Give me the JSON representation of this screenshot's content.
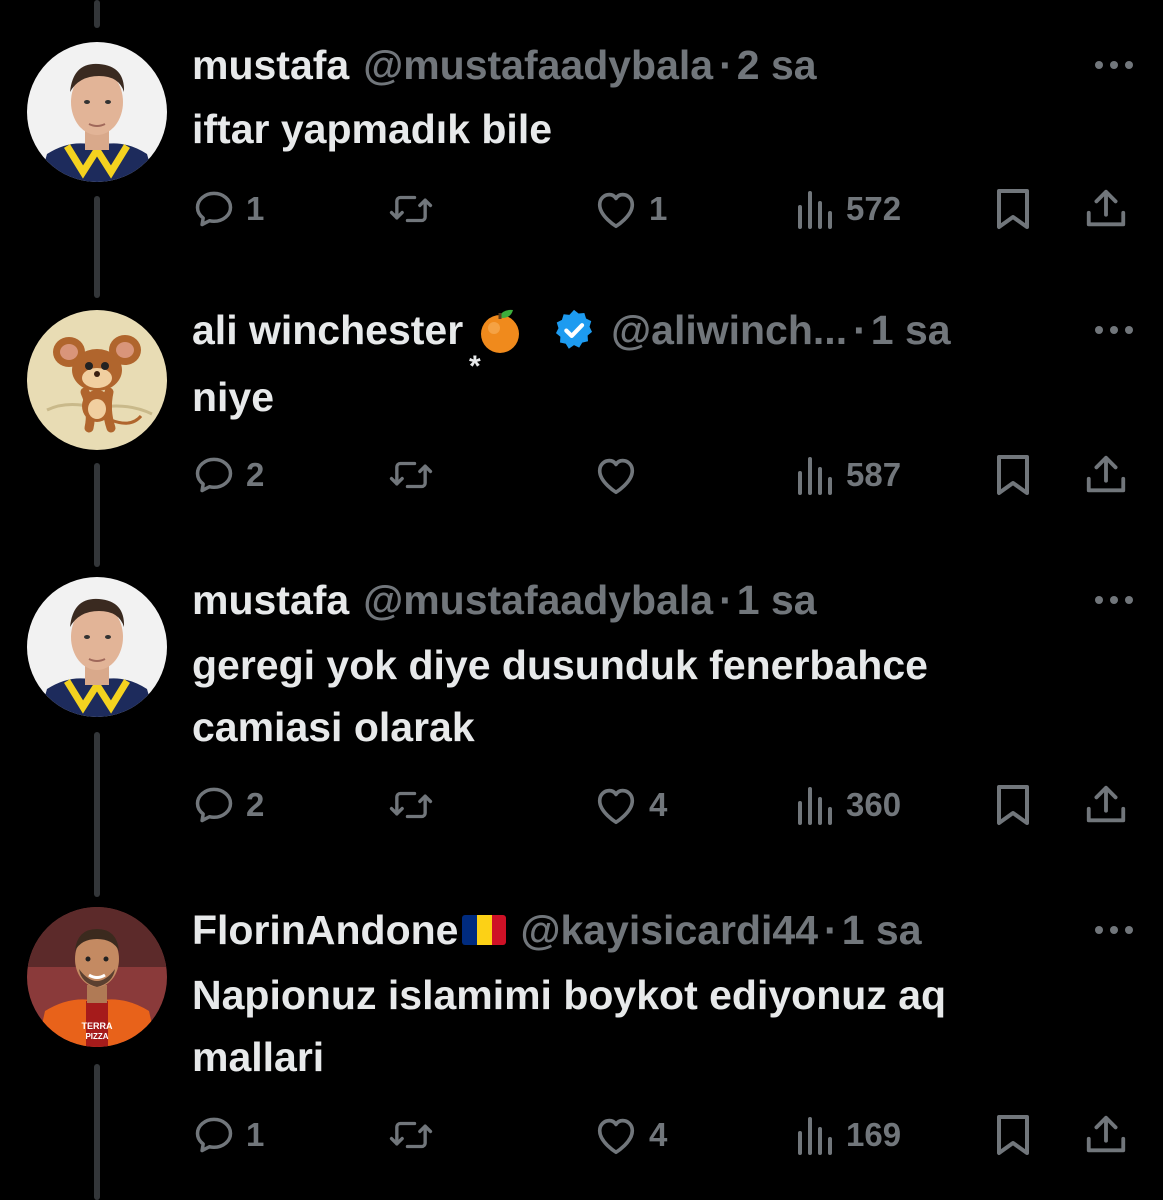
{
  "tweets": [
    {
      "name": "mustafa",
      "handle": "@mustafaadybala",
      "separator": "·",
      "time": "2 sa",
      "lines": [
        "iftar yapmadık bile"
      ],
      "replies": "1",
      "retweets": "",
      "likes": "1",
      "views": "572",
      "avatar": "footballer-avatar-yellow-navy"
    },
    {
      "name": "ali winchester",
      "name_decoration": "*",
      "emoji": "tangerine-emoji",
      "verified": true,
      "handle": "@aliwinch...",
      "separator": "·",
      "time": "1 sa",
      "lines": [
        "niye"
      ],
      "replies": "2",
      "retweets": "",
      "likes": "",
      "views": "587",
      "avatar": "cartoon-mouse-avatar"
    },
    {
      "name": "mustafa",
      "handle": "@mustafaadybala",
      "separator": "·",
      "time": "1 sa",
      "lines": [
        "geregi yok diye dusunduk fenerbahce",
        "camiasi olarak"
      ],
      "replies": "2",
      "retweets": "",
      "likes": "4",
      "views": "360",
      "avatar": "footballer-avatar-yellow-navy"
    },
    {
      "name": "FlorinAndone",
      "flag": "romania-flag",
      "handle": "@kayisicardi44",
      "separator": "·",
      "time": "1 sa",
      "lines": [
        "Napionuz islamimi boykot ediyonuz aq",
        "mallari"
      ],
      "replies": "1",
      "retweets": "",
      "likes": "4",
      "views": "169",
      "avatar": "footballer-avatar-red-orange",
      "avatar_text": [
        "TERRA",
        "PIZZA"
      ]
    }
  ],
  "colors": {
    "background": "#000000",
    "text": "#e7e9ea",
    "muted": "#71767b",
    "thread_line": "#333639",
    "verified": "#1d9bf0",
    "flag_blue": "#002b7f",
    "flag_yellow": "#fcd116",
    "flag_red": "#ce1126"
  }
}
